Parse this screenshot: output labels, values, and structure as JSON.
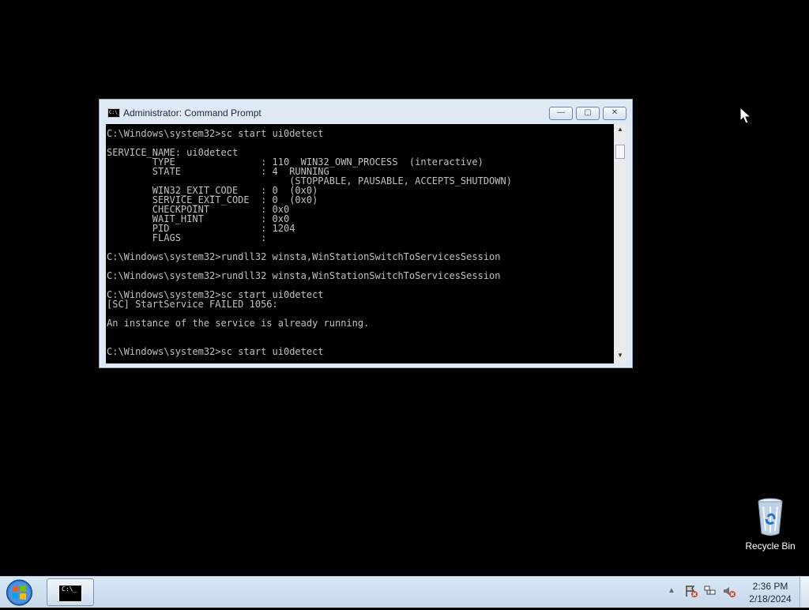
{
  "window": {
    "title": "Administrator: Command Prompt",
    "icon": "cmd-icon",
    "controls": {
      "minimize_icon": "minimize-icon",
      "maximize_icon": "maximize-icon",
      "close_icon": "close-icon"
    }
  },
  "terminal": {
    "output": "C:\\Windows\\system32>sc start ui0detect\n\nSERVICE_NAME: ui0detect\n        TYPE               : 110  WIN32_OWN_PROCESS  (interactive)\n        STATE              : 4  RUNNING\n                                (STOPPABLE, PAUSABLE, ACCEPTS_SHUTDOWN)\n        WIN32_EXIT_CODE    : 0  (0x0)\n        SERVICE_EXIT_CODE  : 0  (0x0)\n        CHECKPOINT         : 0x0\n        WAIT_HINT          : 0x0\n        PID                : 1204\n        FLAGS              :\n\nC:\\Windows\\system32>rundll32 winsta,WinStationSwitchToServicesSession\n\nC:\\Windows\\system32>rundll32 winsta,WinStationSwitchToServicesSession\n\nC:\\Windows\\system32>sc start ui0detect\n[SC] StartService FAILED 1056:\n\nAn instance of the service is already running.\n\n\nC:\\Windows\\system32>sc start ui0detect"
  },
  "desktop": {
    "recycle_bin_label": "Recycle Bin",
    "recycle_bin_icon": "recycle-bin-icon"
  },
  "taskbar": {
    "start_icon": "windows-start-icon",
    "task_button_icon": "cmd-icon",
    "tray": {
      "show_hidden_icon": "chevron-up-icon",
      "action_center_icon": "flag-error-icon",
      "network_icon": "network-icon",
      "volume_icon": "volume-muted-icon"
    },
    "clock": {
      "time": "2:36 PM",
      "date": "2/18/2024"
    }
  },
  "colors": {
    "desktop": "#000000",
    "terminal_bg": "#000000",
    "terminal_text": "#c0c0c0",
    "window_frame": "#dfe9f5",
    "taskbar": "#d3e3f2"
  }
}
